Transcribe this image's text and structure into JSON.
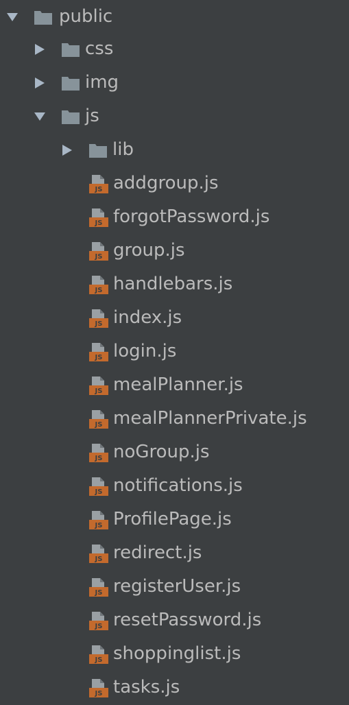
{
  "tree": {
    "root": {
      "label": "public",
      "state": "expanded",
      "icon": "folder-icon",
      "children": [
        {
          "label": "css",
          "state": "collapsed",
          "icon": "folder-icon"
        },
        {
          "label": "img",
          "state": "collapsed",
          "icon": "folder-icon"
        },
        {
          "label": "js",
          "state": "expanded",
          "icon": "folder-icon",
          "children": [
            {
              "label": "lib",
              "state": "collapsed",
              "icon": "folder-icon"
            },
            {
              "label": "addgroup.js",
              "icon": "js-file-icon"
            },
            {
              "label": "forgotPassword.js",
              "icon": "js-file-icon"
            },
            {
              "label": "group.js",
              "icon": "js-file-icon"
            },
            {
              "label": "handlebars.js",
              "icon": "js-file-icon"
            },
            {
              "label": "index.js",
              "icon": "js-file-icon"
            },
            {
              "label": "login.js",
              "icon": "js-file-icon"
            },
            {
              "label": "mealPlanner.js",
              "icon": "js-file-icon"
            },
            {
              "label": "mealPlannerPrivate.js",
              "icon": "js-file-icon"
            },
            {
              "label": "noGroup.js",
              "icon": "js-file-icon"
            },
            {
              "label": "notifications.js",
              "icon": "js-file-icon"
            },
            {
              "label": "ProfilePage.js",
              "icon": "js-file-icon"
            },
            {
              "label": "redirect.js",
              "icon": "js-file-icon"
            },
            {
              "label": "registerUser.js",
              "icon": "js-file-icon"
            },
            {
              "label": "resetPassword.js",
              "icon": "js-file-icon"
            },
            {
              "label": "shoppinglist.js",
              "icon": "js-file-icon"
            },
            {
              "label": "tasks.js",
              "icon": "js-file-icon"
            }
          ]
        }
      ]
    }
  },
  "colors": {
    "background": "#3c3f41",
    "text": "#bbbbbb",
    "folder": "#87939a",
    "arrow": "#a9b7c6",
    "js_badge": "#c36a2d",
    "js_doc": "#9aa0a4"
  },
  "icon_label": {
    "js": "JS"
  }
}
